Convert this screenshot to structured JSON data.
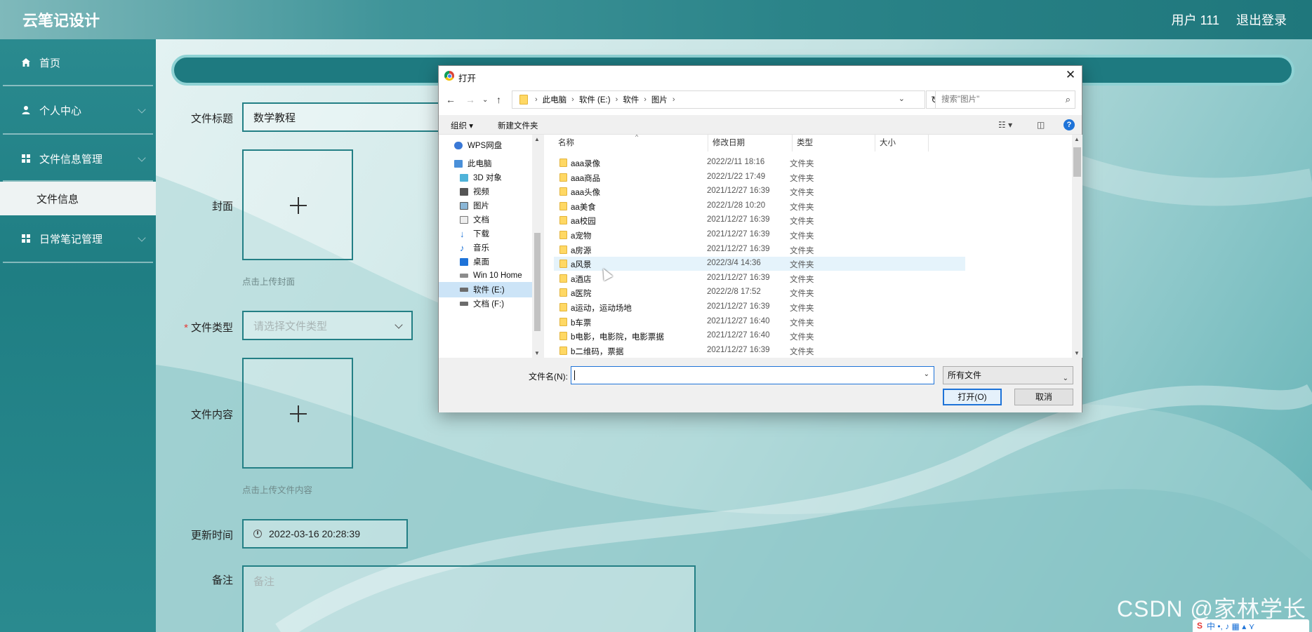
{
  "app": {
    "title": "云笔记设计",
    "user": "用户 111",
    "logout": "退出登录"
  },
  "sidebar": {
    "items": [
      {
        "label": "首页"
      },
      {
        "label": "个人中心"
      },
      {
        "label": "文件信息管理"
      },
      {
        "label": "日常笔记管理"
      }
    ],
    "sub_item": "文件信息"
  },
  "form": {
    "title_label": "文件标题",
    "title_value": "数学教程",
    "cover_label": "封面",
    "cover_hint": "点击上传封面",
    "type_label": "文件类型",
    "type_required_mark": "*",
    "type_placeholder": "请选择文件类型",
    "content_label": "文件内容",
    "content_hint": "点击上传文件内容",
    "time_label": "更新时间",
    "time_value": "2022-03-16 20:28:39",
    "remark_label": "备注",
    "remark_placeholder": "备注"
  },
  "dialog": {
    "title": "打开",
    "breadcrumb": [
      "此电脑",
      "软件 (E:)",
      "软件",
      "图片"
    ],
    "search_placeholder": "搜索\"图片\"",
    "toolbar": {
      "organize": "组织 ▾",
      "new_folder": "新建文件夹"
    },
    "nav_items": [
      {
        "label": "WPS网盘",
        "icon": "cloud-icon"
      },
      {
        "label": "此电脑",
        "icon": "computer-icon"
      },
      {
        "label": "3D 对象",
        "icon": "cube-icon"
      },
      {
        "label": "视频",
        "icon": "video-icon"
      },
      {
        "label": "图片",
        "icon": "picture-icon"
      },
      {
        "label": "文档",
        "icon": "document-icon"
      },
      {
        "label": "下载",
        "icon": "download-icon"
      },
      {
        "label": "音乐",
        "icon": "music-icon"
      },
      {
        "label": "桌面",
        "icon": "desktop-icon"
      },
      {
        "label": "Win 10 Home",
        "icon": "drive-icon"
      },
      {
        "label": "软件 (E:)",
        "icon": "drive-icon",
        "selected": true
      },
      {
        "label": "文档 (F:)",
        "icon": "drive-icon"
      }
    ],
    "columns": [
      "名称",
      "修改日期",
      "类型",
      "大小"
    ],
    "files": [
      {
        "name": "aaa录像",
        "date": "2022/2/11 18:16",
        "type": "文件夹"
      },
      {
        "name": "aaa商品",
        "date": "2022/1/22 17:49",
        "type": "文件夹"
      },
      {
        "name": "aaa头像",
        "date": "2021/12/27 16:39",
        "type": "文件夹"
      },
      {
        "name": "aa美食",
        "date": "2022/1/28 10:20",
        "type": "文件夹"
      },
      {
        "name": "aa校园",
        "date": "2021/12/27 16:39",
        "type": "文件夹"
      },
      {
        "name": "a宠物",
        "date": "2021/12/27 16:39",
        "type": "文件夹"
      },
      {
        "name": "a房源",
        "date": "2021/12/27 16:39",
        "type": "文件夹"
      },
      {
        "name": "a风景",
        "date": "2022/3/4 14:36",
        "type": "文件夹",
        "hover": true
      },
      {
        "name": "a酒店",
        "date": "2021/12/27 16:39",
        "type": "文件夹"
      },
      {
        "name": "a医院",
        "date": "2022/2/8 17:52",
        "type": "文件夹"
      },
      {
        "name": "a运动，运动场地",
        "date": "2021/12/27 16:39",
        "type": "文件夹"
      },
      {
        "name": "b车票",
        "date": "2021/12/27 16:40",
        "type": "文件夹"
      },
      {
        "name": "b电影，电影院，电影票据",
        "date": "2021/12/27 16:40",
        "type": "文件夹"
      },
      {
        "name": "b二维码，票据",
        "date": "2021/12/27 16:39",
        "type": "文件夹"
      }
    ],
    "filename_label": "文件名(N):",
    "filename_value": "",
    "filetype": "所有文件",
    "open_button": "打开(O)",
    "cancel_button": "取消"
  },
  "watermark": "CSDN @家林学长",
  "ime": "中 •, ♪ ▦ ▴ ⋎"
}
